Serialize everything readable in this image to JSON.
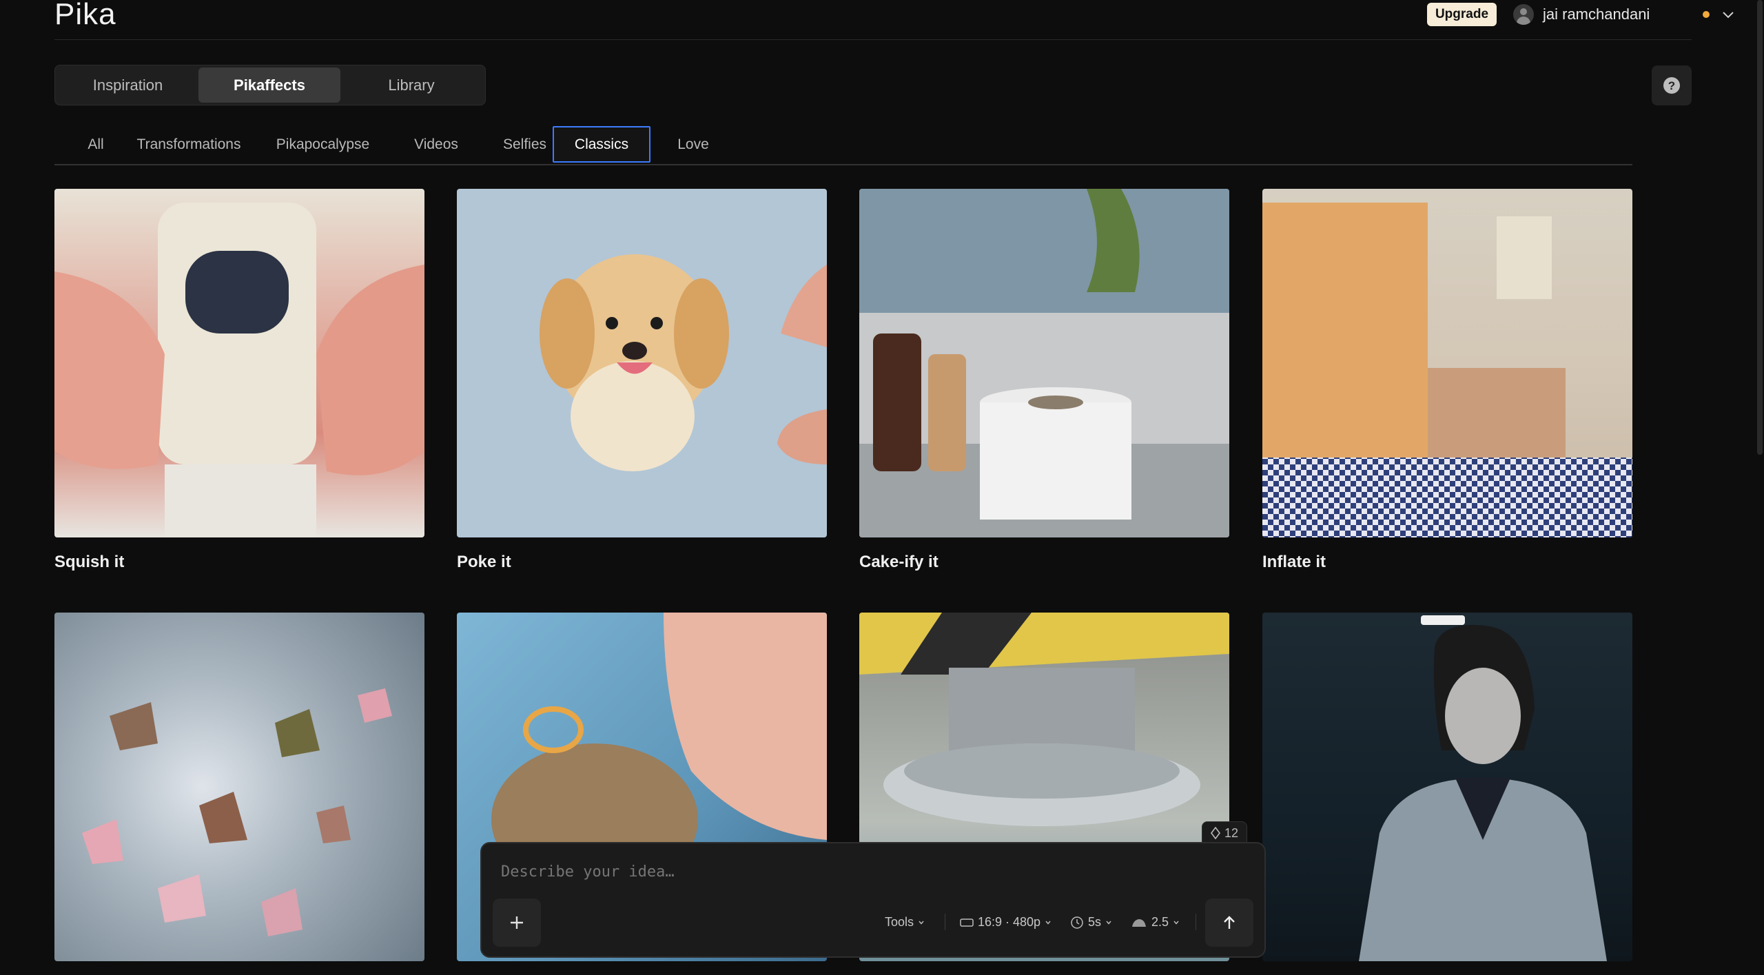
{
  "header": {
    "logo": "Pika",
    "upgrade_label": "Upgrade",
    "user_name": "jai ramchandani"
  },
  "top_tabs": [
    {
      "label": "Inspiration"
    },
    {
      "label": "Pikaffects"
    },
    {
      "label": "Library"
    }
  ],
  "active_top_tab": "Pikaffects",
  "filters": [
    {
      "label": "All"
    },
    {
      "label": "Transformations"
    },
    {
      "label": "Pikapocalypse"
    },
    {
      "label": "Videos"
    },
    {
      "label": "Selfies"
    },
    {
      "label": "Classics"
    },
    {
      "label": "Love"
    }
  ],
  "active_filter": "Classics",
  "cards": [
    {
      "title": "Squish it"
    },
    {
      "title": "Poke it"
    },
    {
      "title": "Cake-ify it"
    },
    {
      "title": "Inflate it"
    }
  ],
  "prompt": {
    "placeholder": "Describe your idea…",
    "credits": "12",
    "tools_label": "Tools",
    "format_label": "16:9 · 480p",
    "duration_label": "5s",
    "model_label": "2.5"
  },
  "colors": {
    "background": "#0d0d0d",
    "accent": "#3d7bff",
    "upgrade": "#f6ecd7",
    "status": "#f2a93b"
  }
}
